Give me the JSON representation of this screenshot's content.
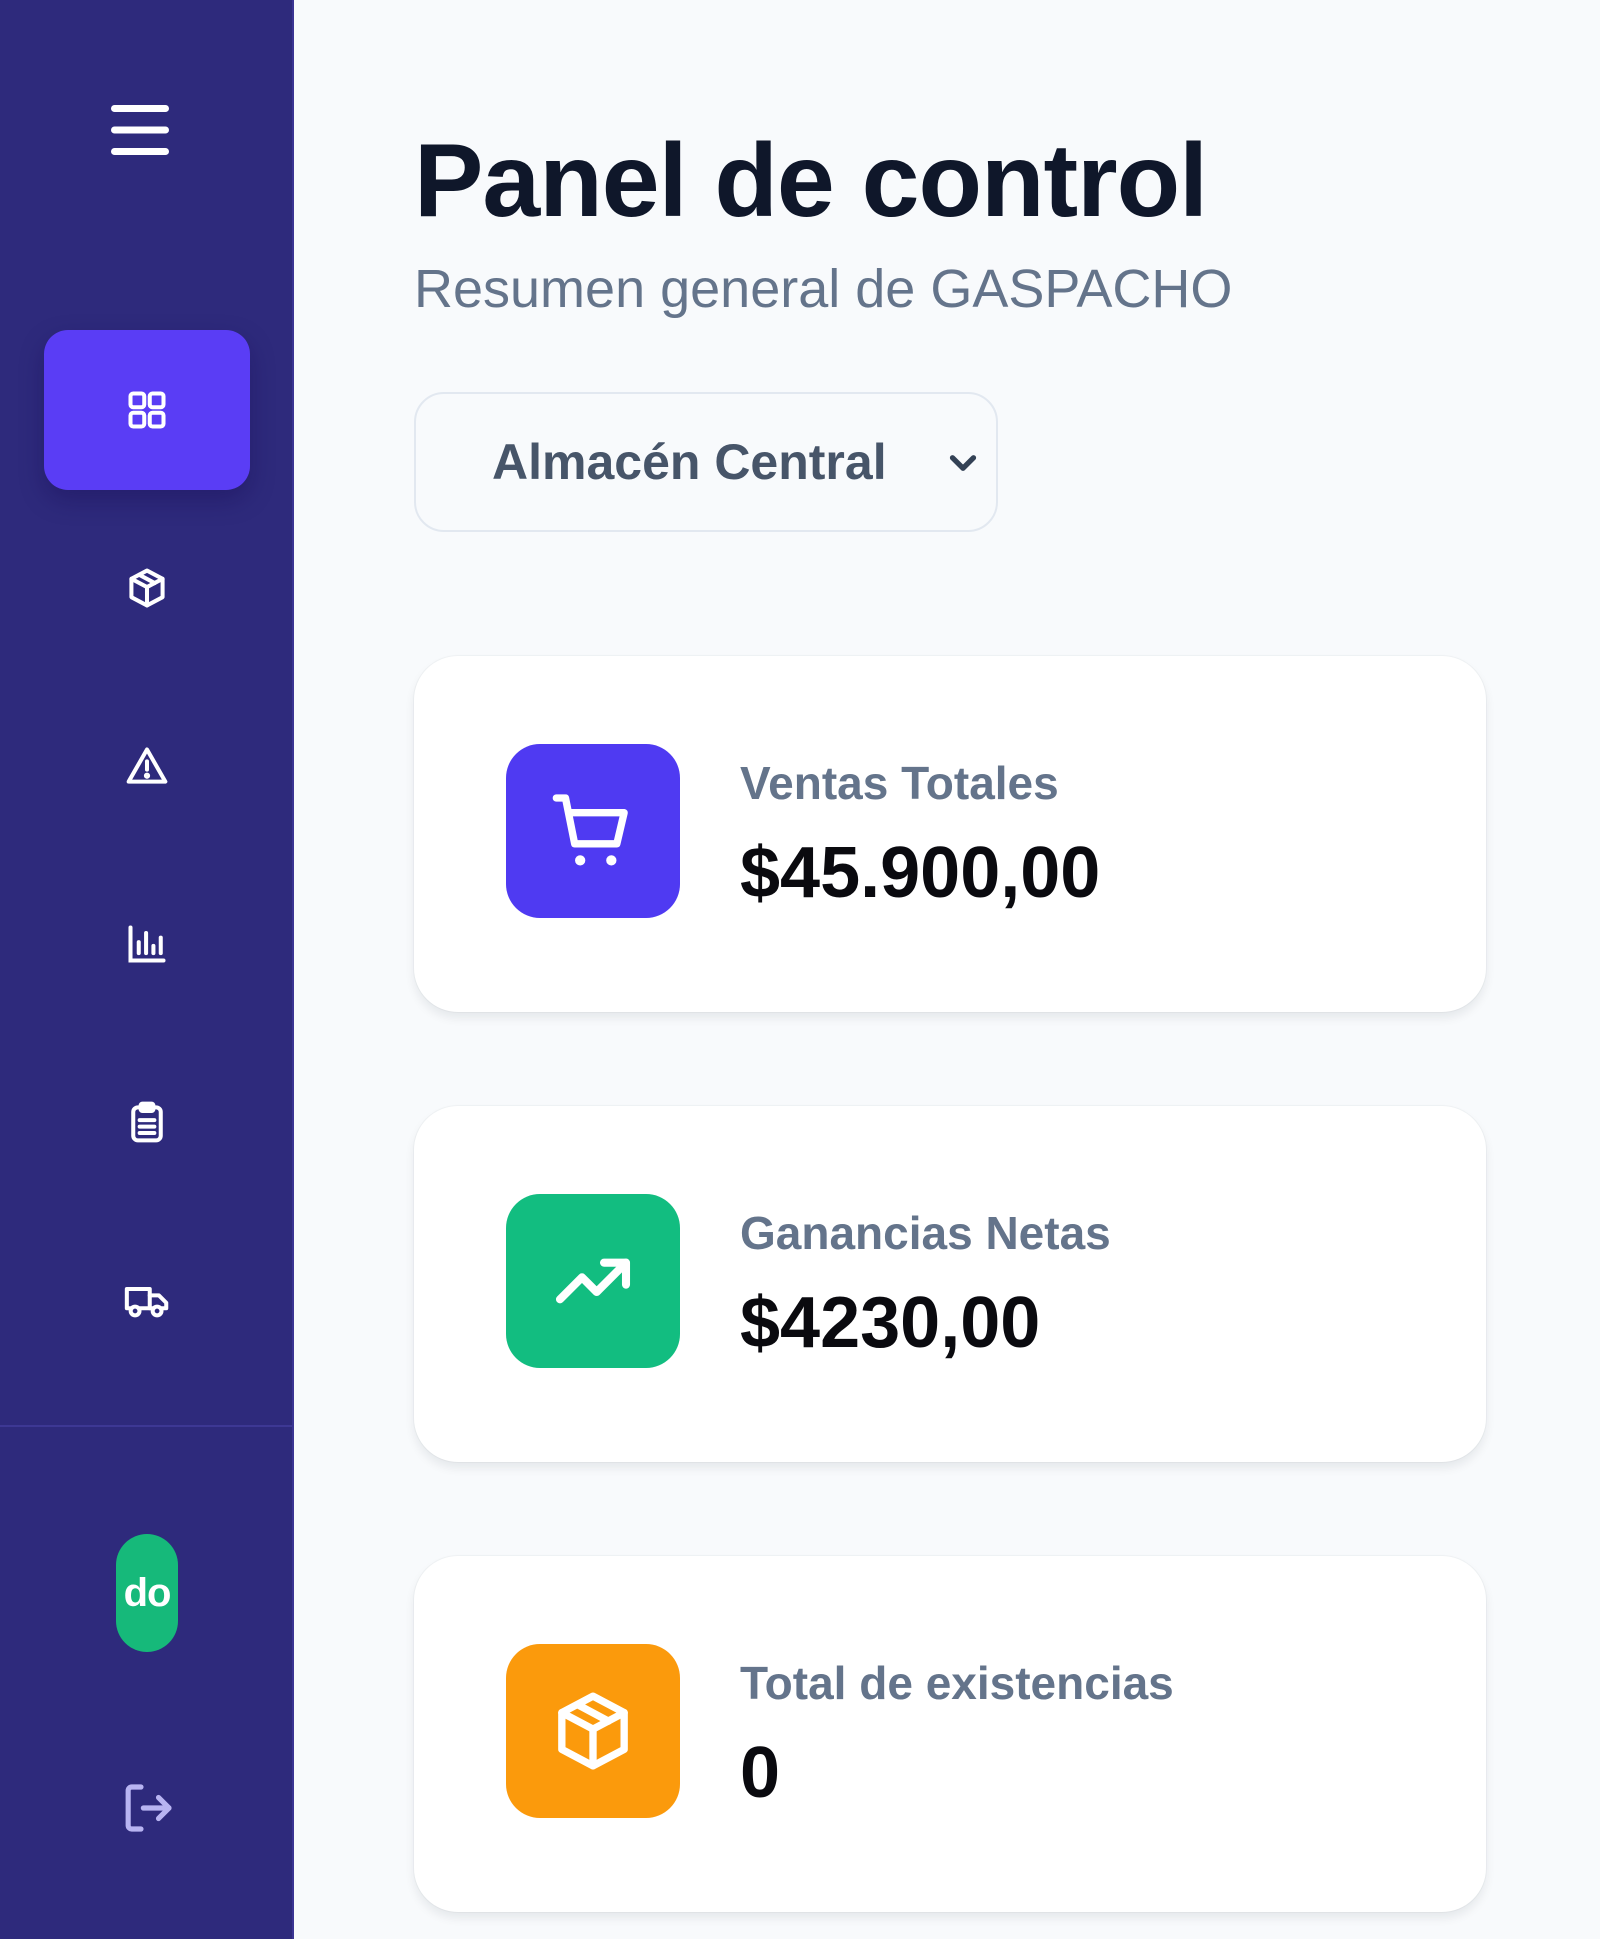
{
  "sidebar": {
    "menu_icon": "hamburger-menu-icon",
    "items": [
      {
        "icon": "dashboard-grid-icon",
        "active": true
      },
      {
        "icon": "package-cube-icon",
        "active": false
      },
      {
        "icon": "warning-triangle-icon",
        "active": false
      },
      {
        "icon": "bar-chart-icon",
        "active": false
      },
      {
        "icon": "clipboard-icon",
        "active": false
      },
      {
        "icon": "truck-icon",
        "active": false
      }
    ],
    "avatar_text": "do",
    "logout_icon": "logout-icon"
  },
  "header": {
    "title": "Panel de control",
    "subtitle": "Resumen general de GASPACHO"
  },
  "warehouse_select": {
    "value": "Almacén Central"
  },
  "stats": [
    {
      "label": "Ventas Totales",
      "value": "$45.900,00",
      "icon": "shopping-cart-icon",
      "color": "#4f3af2"
    },
    {
      "label": "Ganancias Netas",
      "value": "$4230,00",
      "icon": "trending-up-icon",
      "color": "#12bd80"
    },
    {
      "label": "Total de existencias",
      "value": "0",
      "icon": "box-icon",
      "color": "#fb9a0c"
    }
  ],
  "colors": {
    "sidebar_bg": "#2e2a7c",
    "active_nav": "#5a3df5",
    "avatar_bg": "#16b97a"
  }
}
